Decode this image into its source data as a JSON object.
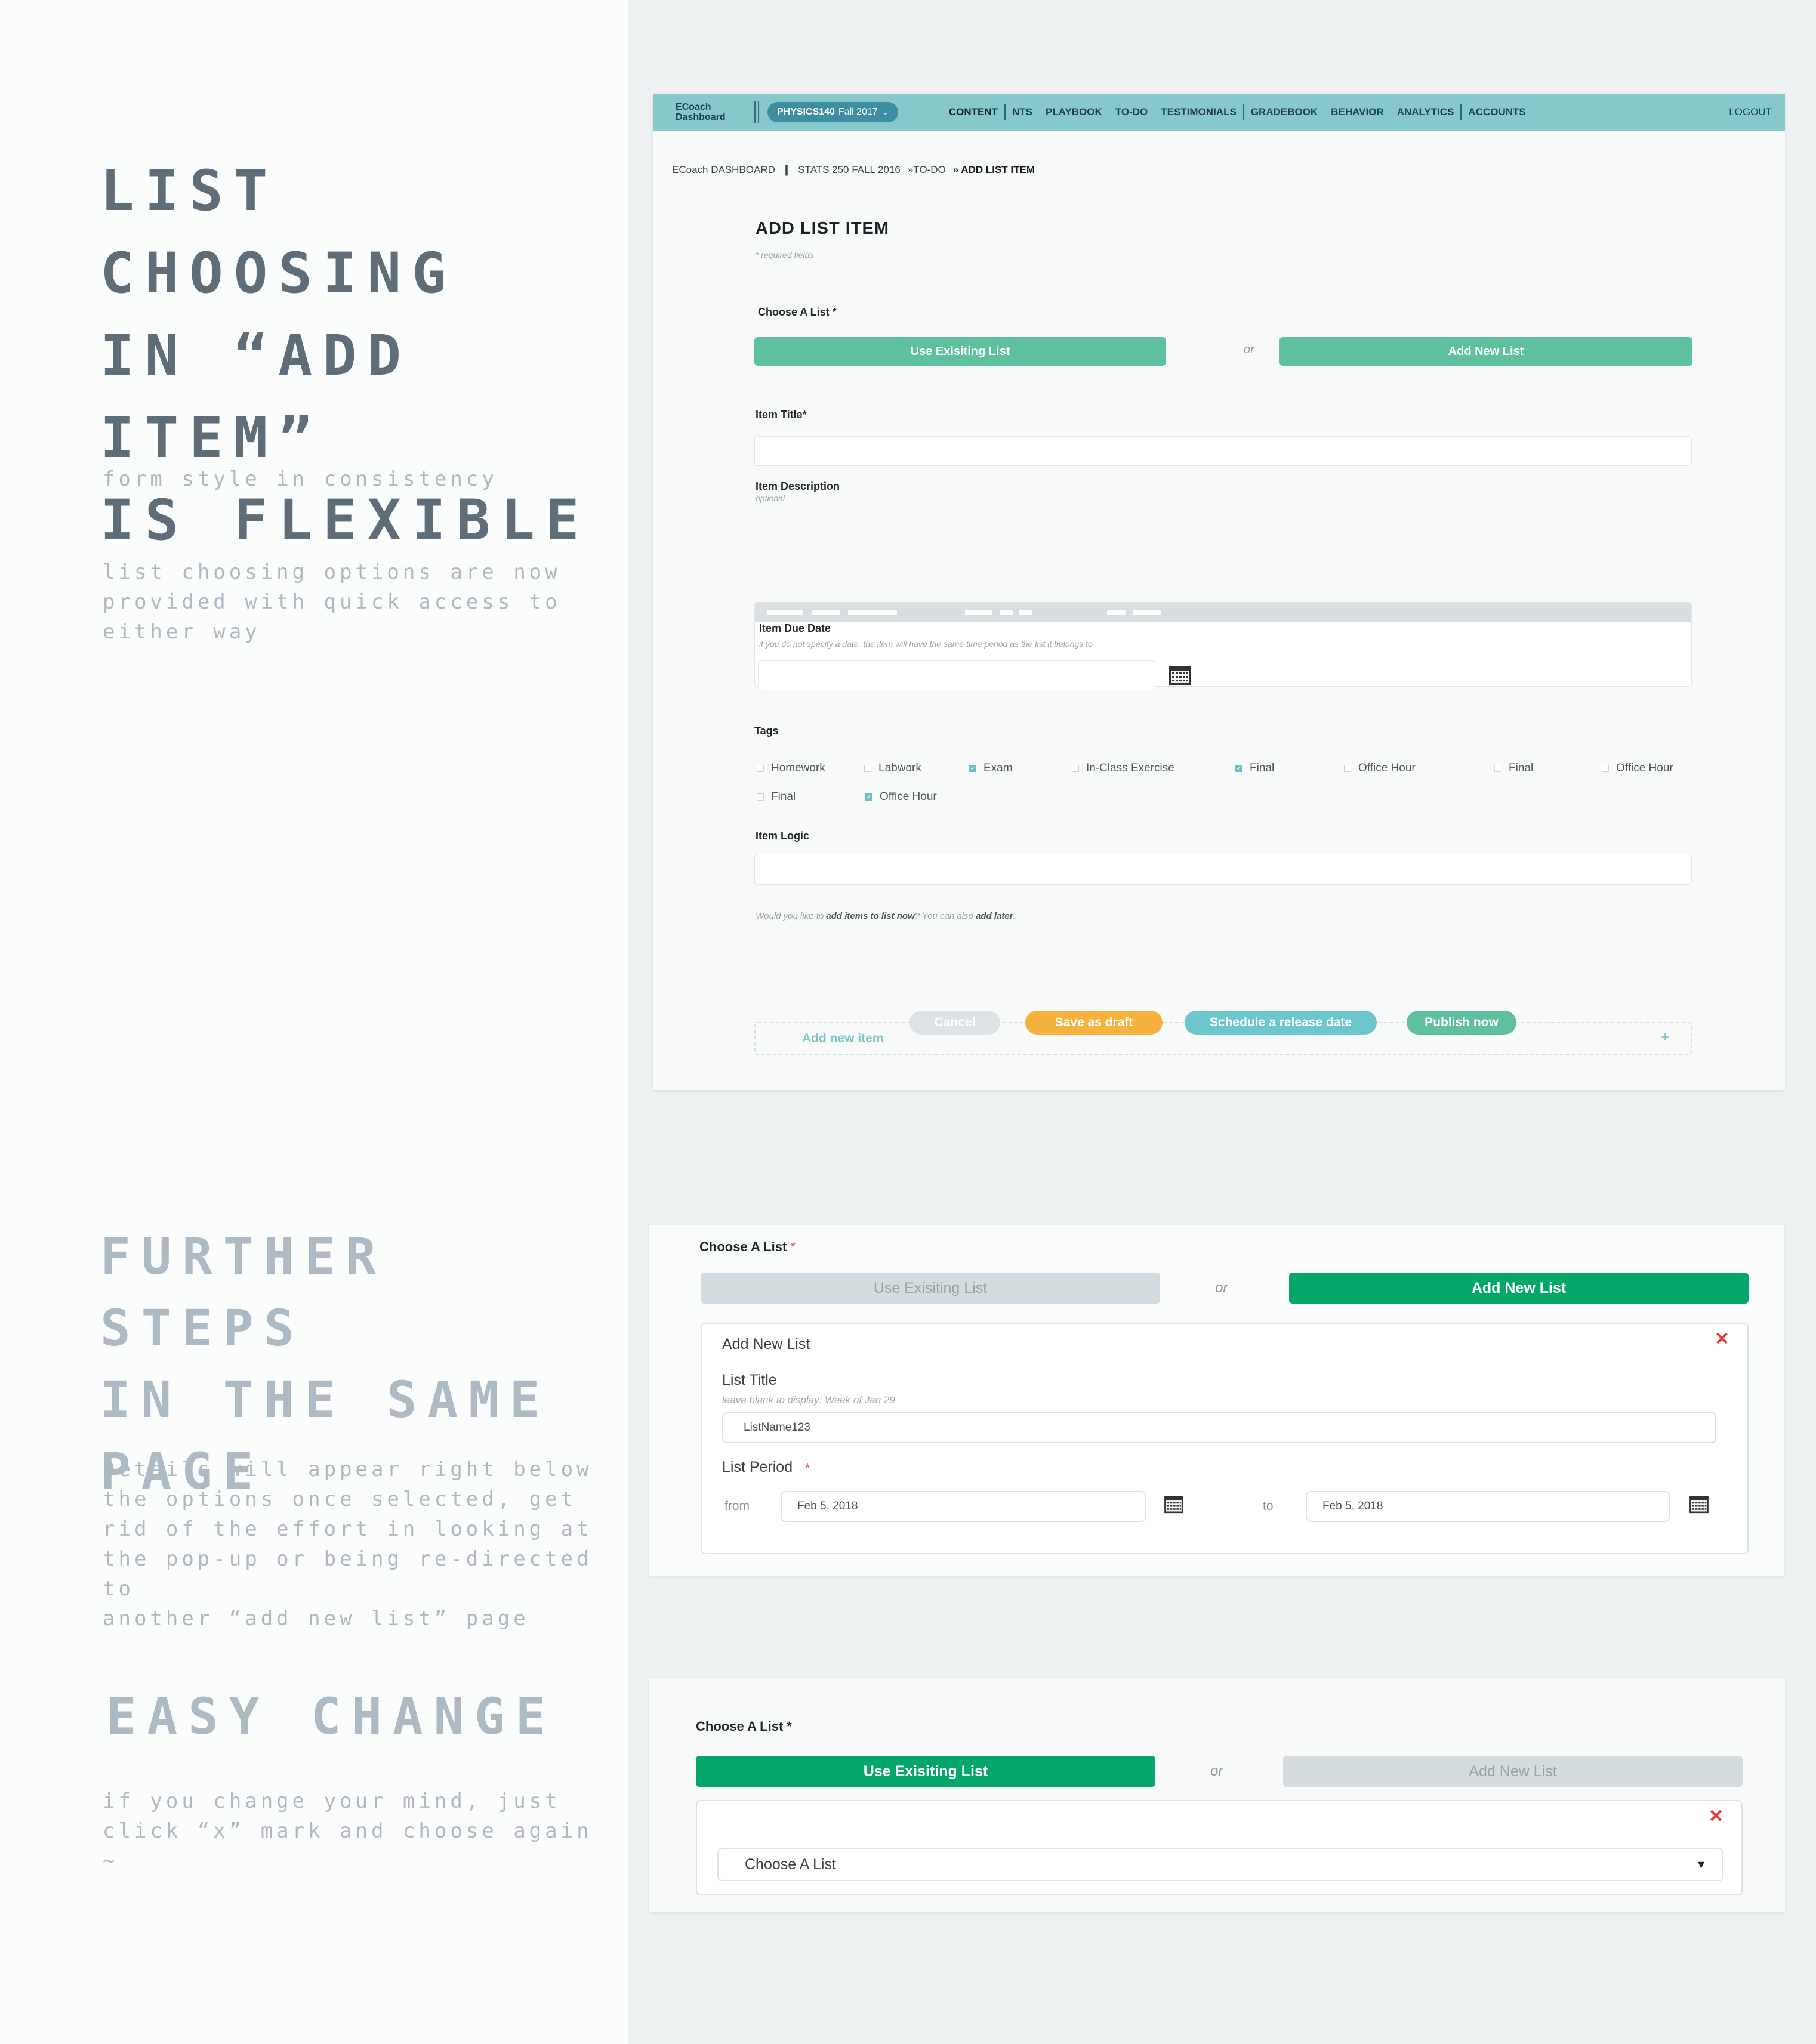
{
  "annotations": {
    "heading1": "LIST CHOOSING\nIN “ADD ITEM”\nIS FLEXIBLE",
    "note1a": "form style in consistency",
    "note1b": "list choosing options are now\nprovided with quick access to\neither way",
    "heading2": "FURTHER STEPS\nIN THE SAME\nPAGE",
    "note2": "Details will appear right below\nthe options once selected, get\nrid of the effort in looking at\nthe pop-up or being re-directed to\nanother “add new list” page",
    "heading3": "EASY CHANGE",
    "note3": "if you change your mind, just\nclick “x” mark and choose again\n~"
  },
  "nav": {
    "brand": "ECoach\nDashboard",
    "course_code": "PHYSICS140",
    "course_term": "Fall 2017",
    "items": [
      "CONTENT",
      "NTS",
      "PLAYBOOK",
      "TO-DO",
      "TESTIMONIALS",
      "GRADEBOOK",
      "BEHAVIOR",
      "ANALYTICS",
      "ACCOUNTS"
    ],
    "logout": "LOGOUT"
  },
  "breadcrumb": {
    "home": "ECoach DASHBOARD",
    "course": "STATS 250 FALL 2016",
    "section": "»TO-DO",
    "current": "» ADD LIST ITEM"
  },
  "form": {
    "title": "ADD LIST ITEM",
    "required_note": "* required fields",
    "choose_list_label": "Choose A List *",
    "use_existing": "Use Exisiting List",
    "or": "or",
    "add_new_list": "Add New List",
    "item_title_label": "Item Title*",
    "item_desc_label": "Item Description",
    "item_desc_hint": "optional",
    "due_date_label": "Item Due Date",
    "due_date_hint": "if you do not specify a date, the item will have the same time period as the list it belongs to",
    "tags_label": "Tags",
    "tags": [
      {
        "label": "Homework",
        "checked": false
      },
      {
        "label": "Labwork",
        "checked": false
      },
      {
        "label": "Exam",
        "checked": true
      },
      {
        "label": "In-Class Exercise",
        "checked": false
      },
      {
        "label": "Final",
        "checked": true
      },
      {
        "label": "Office Hour",
        "checked": false
      },
      {
        "label": "Final",
        "checked": false
      },
      {
        "label": "Office Hour",
        "checked": false
      },
      {
        "label": "Final",
        "checked": false
      },
      {
        "label": "Office Hour",
        "checked": true
      }
    ],
    "logic_label": "Item Logic",
    "add_items_prompt_a": "Would you like to ",
    "add_items_prompt_b": "add items to list now",
    "add_items_prompt_c": "? You can also ",
    "add_items_prompt_d": "add later",
    "add_items_prompt_e": ".",
    "add_new_item": "Add new item",
    "plus": "+",
    "buttons": {
      "cancel": "Cancel",
      "draft": "Save as draft",
      "schedule": "Schedule a release date",
      "publish": "Publish now"
    }
  },
  "panel_new_list": {
    "label": "Choose A List",
    "star": "*",
    "use_existing": "Use Exisiting List",
    "or": "or",
    "add_new_list": "Add New List",
    "box_title": "Add New List",
    "close": "✕",
    "list_title_label": "List Title",
    "list_title_hint": "leave blank to display: Week of Jan 29",
    "list_title_value": "ListName123",
    "list_period_label": "List Period",
    "list_period_star": "*",
    "from_label": "from",
    "from_value": "Feb 5, 2018",
    "to_label": "to",
    "to_value": "Feb 5, 2018"
  },
  "panel_existing": {
    "label": "Choose A List *",
    "use_existing": "Use Exisiting List",
    "or": "or",
    "add_new_list": "Add New List",
    "close": "✕",
    "select_placeholder": "Choose A List",
    "select_arrow": "▾"
  },
  "colors": {
    "nav_bg": "#86c8cc",
    "teal_button": "#5ec0a0",
    "green_active": "#05a66a",
    "orange": "#f5b23e",
    "aqua": "#6cc7cc",
    "close_red": "#e53a3a"
  }
}
